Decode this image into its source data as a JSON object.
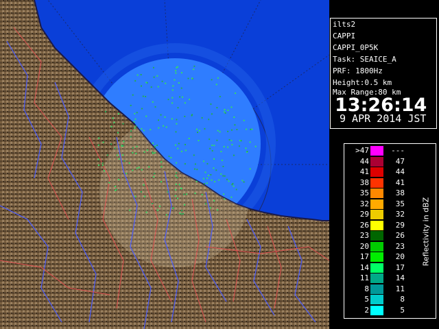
{
  "info": {
    "site": "ilts2",
    "product": "CAPPI",
    "product_name": "CAPPI_0P5K",
    "task": "Task: SEAICE_A",
    "prf": "PRF: 1800Hz",
    "height": "Height:0.5 km",
    "max_range": "Max Range:80 km",
    "time": "13:26:14",
    "date": "9 APR 2014 JST"
  },
  "legend": {
    "title": "Reflectivity in dBZ",
    "rows": [
      {
        "low": ">47",
        "high": "---",
        "color": "#ff00ff"
      },
      {
        "low": "44",
        "high": "47",
        "color": "#aa0033"
      },
      {
        "low": "41",
        "high": "44",
        "color": "#dd0000"
      },
      {
        "low": "38",
        "high": "41",
        "color": "#ff3300"
      },
      {
        "low": "35",
        "high": "38",
        "color": "#ff8800"
      },
      {
        "low": "32",
        "high": "35",
        "color": "#ffaa00"
      },
      {
        "low": "29",
        "high": "32",
        "color": "#eecc00"
      },
      {
        "low": "26",
        "high": "29",
        "color": "#ffff00"
      },
      {
        "low": "23",
        "high": "26",
        "color": "#006600"
      },
      {
        "low": "20",
        "high": "23",
        "color": "#00cc00"
      },
      {
        "low": "17",
        "high": "20",
        "color": "#00ee00"
      },
      {
        "low": "14",
        "high": "17",
        "color": "#00ff66"
      },
      {
        "low": "11",
        "high": "14",
        "color": "#00aa88"
      },
      {
        "low": "8",
        "high": "11",
        "color": "#009999"
      },
      {
        "low": "5",
        "high": "8",
        "color": "#00cccc"
      },
      {
        "low": "2",
        "high": "5",
        "color": "#00ffff"
      }
    ]
  },
  "map": {
    "sea_color": "#0a3fd8",
    "land_color": "#7a6040",
    "echo_zone_color": "#2f7dff"
  }
}
